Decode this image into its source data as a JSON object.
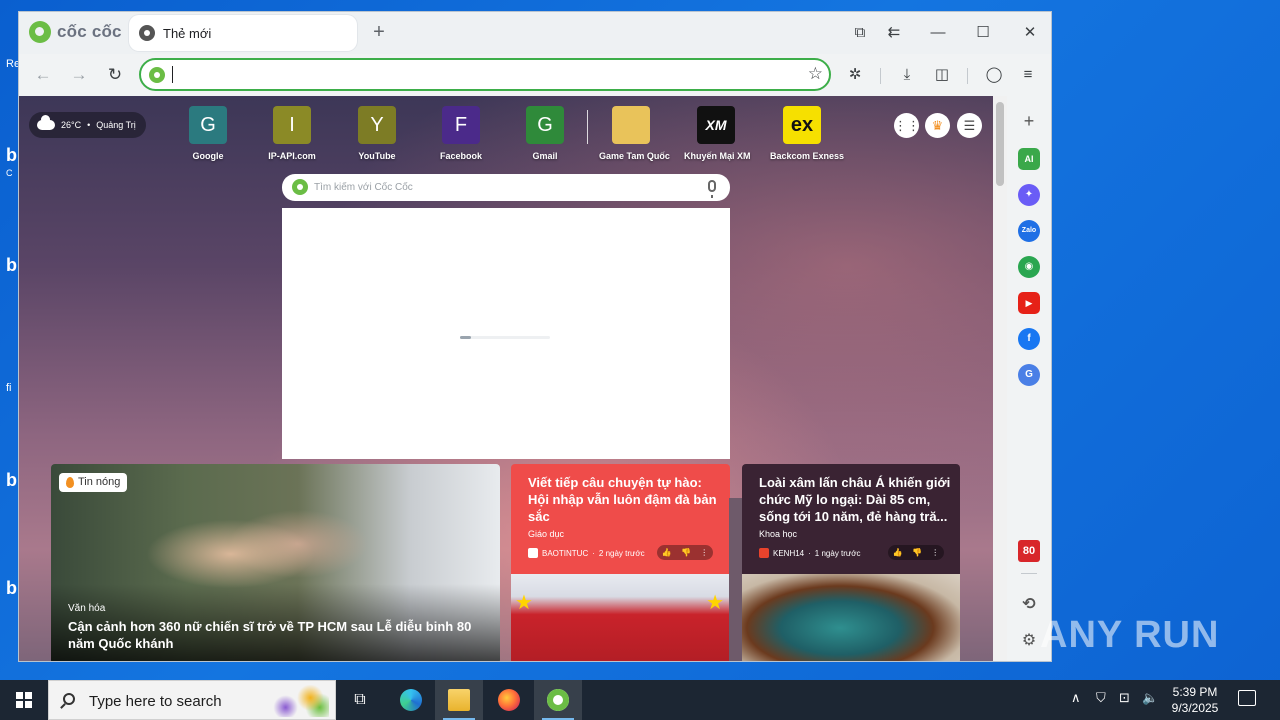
{
  "desktop": {
    "fragments": [
      "Re",
      "b",
      "C",
      "b",
      "fi",
      "b",
      "b"
    ]
  },
  "browser": {
    "brand": "cốc cốc",
    "tab": {
      "title": "Thẻ mới"
    },
    "omnibox": {
      "value": "",
      "placeholder": ""
    }
  },
  "page": {
    "weather": {
      "temp": "26°C",
      "sep": "•",
      "location": "Quảng Trị"
    },
    "speed_dials": [
      {
        "letter": "G",
        "label": "Google",
        "color": "#2b7a7f"
      },
      {
        "letter": "I",
        "label": "IP-API.com",
        "color": "#8b8a26"
      },
      {
        "letter": "Y",
        "label": "YouTube",
        "color": "#7d7c25"
      },
      {
        "letter": "F",
        "label": "Facebook",
        "color": "#4b2a8a"
      },
      {
        "letter": "G",
        "label": "Gmail",
        "color": "#2f8a3a"
      },
      {
        "letter": "",
        "label": "Game Tam Quốc",
        "color": "#e9c35a"
      },
      {
        "letter": "XM",
        "label": "Khuyến Mại XM",
        "color": "#111111"
      },
      {
        "letter": "ex",
        "label": "Backcom Exness",
        "color": "#f6e000"
      }
    ],
    "search": {
      "placeholder": "Tìm kiếm với Cốc Cốc"
    },
    "loader_progress": 0.12,
    "hero": {
      "badge": "Tin nóng",
      "category": "Văn hóa",
      "title": "Cận cảnh hơn 360 nữ chiến sĩ trở về TP HCM sau Lễ diễu binh 80 năm Quốc khánh"
    },
    "card_red": {
      "title": "Viết tiếp câu chuyện tự hào: Hội nhập vẫn luôn đậm đà bản sắc",
      "category": "Giáo dục",
      "source": "BAOTINTUC",
      "time": "2 ngày trước"
    },
    "card_dark": {
      "title": "Loài xâm lấn châu Á khiến giới chức Mỹ lo ngại: Dài 85 cm, sống tới 10 năm, đẻ hàng tră...",
      "category": "Khoa học",
      "source": "KENH14",
      "time": "1 ngày trước"
    },
    "time_sep": "·"
  },
  "sidebar": {
    "items": [
      {
        "name": "add",
        "glyph": "+",
        "color": "transparent",
        "fg": "#555"
      },
      {
        "name": "ai",
        "glyph": "AI",
        "color": "#3aa84a",
        "fg": "#fff"
      },
      {
        "name": "messenger",
        "glyph": "✦",
        "color": "#6a5cf6",
        "fg": "#fff"
      },
      {
        "name": "zalo",
        "glyph": "Zalo",
        "color": "#1f6fe5",
        "fg": "#fff"
      },
      {
        "name": "game",
        "glyph": "◉",
        "color": "#2aa650",
        "fg": "#fff"
      },
      {
        "name": "youtube",
        "glyph": "▶",
        "color": "#e62117",
        "fg": "#fff"
      },
      {
        "name": "facebook",
        "glyph": "f",
        "color": "#1877f2",
        "fg": "#fff"
      },
      {
        "name": "translate",
        "glyph": "G",
        "color": "#4a7fe6",
        "fg": "#fff"
      }
    ],
    "bottom": {
      "badge": "80",
      "history": "⟲",
      "settings": "⚙"
    }
  },
  "watermark": "ANY RUN",
  "taskbar": {
    "search_placeholder": "Type here to search",
    "time": "5:39 PM",
    "date": "9/3/2025"
  },
  "colors": {
    "accent": "#3dae49",
    "desktop": "#0d63d2",
    "taskbar": "#1c2633",
    "news_red": "#ef4c4a"
  }
}
